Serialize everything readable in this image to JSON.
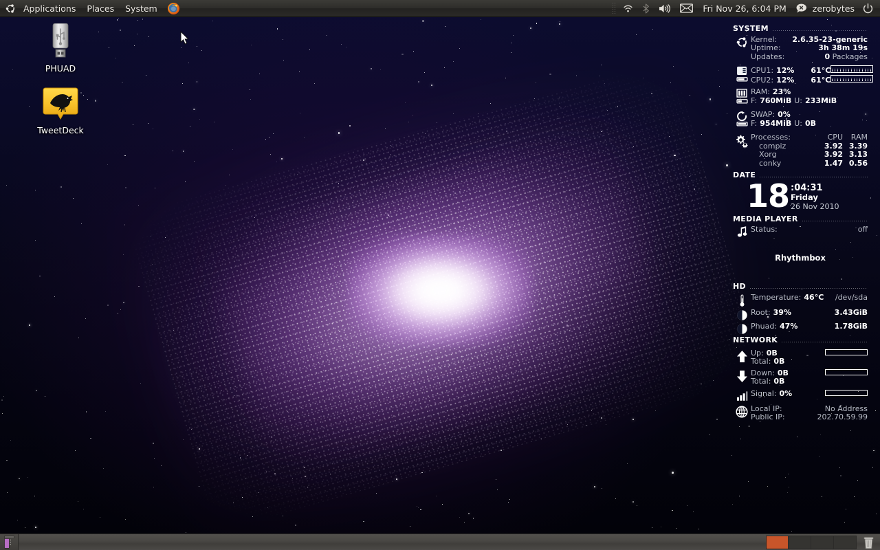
{
  "desktop": {
    "wallpaper_name": "galaxy-wallpaper",
    "accent_color": "#c8552a",
    "icons": [
      {
        "label": "PHUAD",
        "icon": "usb-drive-icon"
      },
      {
        "label": "TweetDeck",
        "icon": "tweetdeck-bird-icon"
      }
    ]
  },
  "top_panel": {
    "logo": "ubuntu-logo-icon",
    "menus": [
      {
        "label": "Applications"
      },
      {
        "label": "Places"
      },
      {
        "label": "System"
      }
    ],
    "launchers": [
      {
        "name": "firefox-launcher",
        "icon": "firefox-icon"
      }
    ],
    "tray": [
      {
        "name": "network-indicator",
        "icon": "wifi-icon"
      },
      {
        "name": "bluetooth-indicator",
        "icon": "bluetooth-icon"
      },
      {
        "name": "sound-indicator",
        "icon": "volume-icon"
      },
      {
        "name": "messaging-indicator",
        "icon": "envelope-icon"
      }
    ],
    "clock": "Fri Nov 26,  6:04 PM",
    "user_status_icon": "chat-bubble-offline-icon",
    "username": "zerobytes",
    "session_icon": "power-icon"
  },
  "bottom_panel": {
    "show_desktop_label": "show-desktop",
    "workspaces": [
      {
        "name": "workspace-1",
        "active": true
      },
      {
        "name": "workspace-2",
        "active": false
      },
      {
        "name": "workspace-3",
        "active": false
      },
      {
        "name": "workspace-4",
        "active": false
      }
    ],
    "trash_label": "trash-icon"
  },
  "conky": {
    "system": {
      "heading": "SYSTEM",
      "kernel_label": "Kernel:",
      "kernel_value": "2.6.35-23-generic",
      "uptime_label": "Uptime:",
      "uptime_value": "3h 38m 19s",
      "updates_label": "Updates:",
      "updates_value": "0",
      "updates_unit": "Packages",
      "cpu1_label": "CPU1:",
      "cpu1_value": "12%",
      "cpu1_temp": "61°C",
      "cpu2_label": "CPU2:",
      "cpu2_value": "12%",
      "cpu2_temp": "61°C",
      "ram_label": "RAM:",
      "ram_value": "23%",
      "ram_free_label": "F:",
      "ram_free_value": "760MiB",
      "ram_used_label": "U:",
      "ram_used_value": "233MiB",
      "swap_label": "SWAP:",
      "swap_value": "0%",
      "swap_free_label": "F:",
      "swap_free_value": "954MiB",
      "swap_used_label": "U:",
      "swap_used_value": "0B",
      "processes_label": "Processes:",
      "col_cpu": "CPU",
      "col_ram": "RAM",
      "processes": [
        {
          "name": "compiz",
          "cpu": "3.92",
          "ram": "3.39"
        },
        {
          "name": "Xorg",
          "cpu": "3.92",
          "ram": "3.13"
        },
        {
          "name": "conky",
          "cpu": "1.47",
          "ram": "0.56"
        }
      ]
    },
    "date": {
      "heading": "DATE",
      "day_number": "18",
      "time": ":04:31",
      "weekday": "Friday",
      "full_date": "26 Nov 2010"
    },
    "media": {
      "heading": "MEDIA PLAYER",
      "status_label": "Status:",
      "status_value": "off",
      "player_name": "Rhythmbox"
    },
    "hd": {
      "heading": "HD",
      "temp_label": "Temperature:",
      "temp_value": "46°C",
      "device": "/dev/sda",
      "root_label": "Root:",
      "root_value": "39%",
      "root_size": "3.43GiB",
      "phuad_label": "Phuad:",
      "phuad_value": "47%",
      "phuad_size": "1.78GiB"
    },
    "network": {
      "heading": "NETWORK",
      "up_label": "Up:",
      "up_value": "0B",
      "up_total_label": "Total:",
      "up_total_value": "0B",
      "down_label": "Down:",
      "down_value": "0B",
      "down_total_label": "Total:",
      "down_total_value": "0B",
      "signal_label": "Signal:",
      "signal_value": "0%",
      "local_ip_label": "Local IP:",
      "local_ip_value": "No Address",
      "public_ip_label": "Public IP:",
      "public_ip_value": "202.70.59.99"
    }
  }
}
